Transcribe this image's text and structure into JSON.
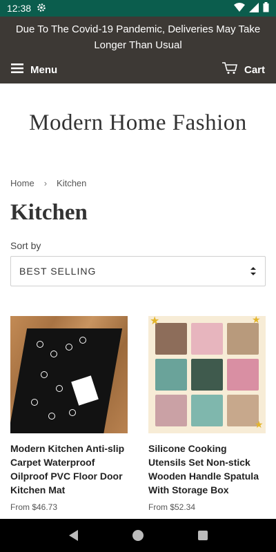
{
  "status": {
    "time": "12:38"
  },
  "announcement": "Due To The Covid-19 Pandemic, Deliveries May Take Longer Than Usual",
  "nav": {
    "menu_label": "Menu",
    "cart_label": "Cart"
  },
  "store": {
    "name": "Modern Home Fashion"
  },
  "breadcrumb": {
    "home": "Home",
    "separator": "›",
    "current": "Kitchen"
  },
  "page": {
    "title": "Kitchen"
  },
  "sort": {
    "label": "Sort by",
    "selected": "BEST SELLING"
  },
  "products": [
    {
      "title": "Modern Kitchen Anti-slip Carpet Waterproof Oilproof PVC Floor Door Kitchen Mat",
      "price": "From $46.73"
    },
    {
      "title": "Silicone Cooking Utensils Set Non-stick Wooden Handle Spatula With Storage Box",
      "price": "From $52.34"
    }
  ],
  "colors": {
    "status_bar": "#0b5d4d",
    "header_bg": "#3d3935",
    "text": "#333333"
  }
}
